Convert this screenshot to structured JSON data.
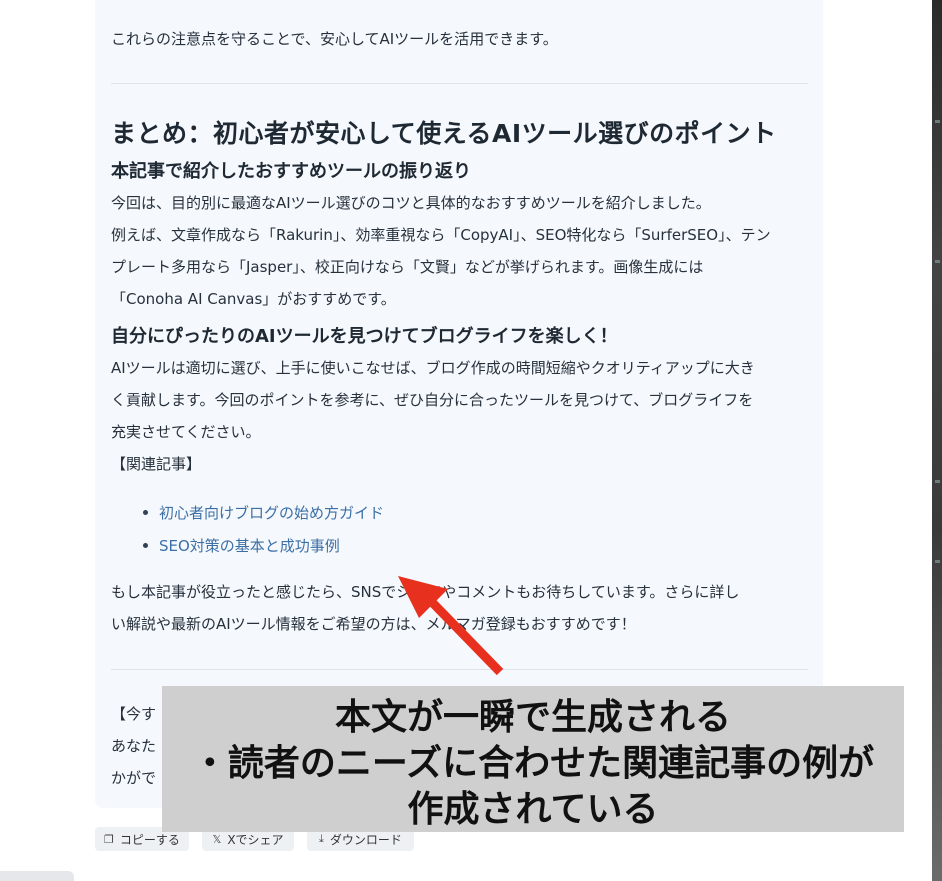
{
  "article": {
    "intro_closing": "これらの注意点を守ることで、安心してAIツールを活用できます。",
    "heading": "まとめ：初心者が安心して使えるAIツール選びのポイント",
    "sub1": "本記事で紹介したおすすめツールの振り返り",
    "sub1_lines": [
      "今回は、目的別に最適なAIツール選びのコツと具体的なおすすめツールを紹介しました。",
      "例えば、文章作成なら「Rakurin」、効率重視なら「CopyAI」、SEO特化なら「SurferSEO」、テン",
      "プレート多用なら「Jasper」、校正向けなら「文賢」などが挙げられます。画像生成には",
      "「Conoha AI Canvas」がおすすめです。"
    ],
    "sub2": "自分にぴったりのAIツールを見つけてブログライフを楽しく！",
    "sub2_lines": [
      "AIツールは適切に選び、上手に使いこなせば、ブログ作成の時間短縮やクオリティアップに大き",
      "く貢献します。今回のポイントを参考に、ぜひ自分に合ったツールを見つけて、ブログライフを",
      "充実させてください。"
    ],
    "related_label": "【関連記事】",
    "related_links": [
      "初心者向けブログの始め方ガイド",
      "SEO対策の基本と成功事例"
    ],
    "closing_lines": [
      "もし本記事が役立ったと感じたら、SNSでシェアやコメントもお待ちしています。さらに詳し",
      "い解説や最新のAIツール情報をご希望の方は、メルマガ登録もおすすめです！"
    ],
    "cta_partial": [
      "【今す",
      "あなた",
      "かがで"
    ]
  },
  "actions": {
    "copy": "コピーする",
    "share_x": "Xでシェア",
    "download": "ダウンロード"
  },
  "icons": {
    "copy": "copy-icon",
    "x": "x-logo-icon",
    "download": "download-icon"
  },
  "annotation": {
    "lines": [
      "本文が一瞬で生成される",
      "・読者のニーズに合わせた関連記事の例が",
      "作成されている"
    ],
    "arrow_color": "#e8301e"
  }
}
